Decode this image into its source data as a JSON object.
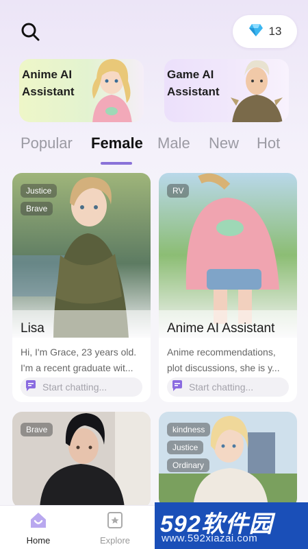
{
  "header": {
    "search_icon": "search-icon",
    "gem_icon": "diamond-icon",
    "gem_count": "13"
  },
  "assistants": [
    {
      "label": "Anime AI Assistant"
    },
    {
      "label": "Game AI Assistant"
    }
  ],
  "tabs": [
    {
      "label": "Popular",
      "active": false
    },
    {
      "label": "Female",
      "active": true
    },
    {
      "label": "Male",
      "active": false
    },
    {
      "label": "New",
      "active": false
    },
    {
      "label": "Hot",
      "active": false
    }
  ],
  "cards": [
    {
      "tags": [
        "Justice",
        "Brave"
      ],
      "name": "Lisa",
      "desc_line1": "Hi, I'm Grace, 23 years old.",
      "desc_line2": "I'm a recent graduate wit...",
      "chat_label": "Start chatting..."
    },
    {
      "tags": [
        "RV"
      ],
      "name": "Anime AI Assistant",
      "desc_line1": "Anime recommendations,",
      "desc_line2": "plot discussions, she is y...",
      "chat_label": "Start chatting..."
    },
    {
      "tags": [
        "Brave"
      ]
    },
    {
      "tags": [
        "kindness",
        "Justice",
        "Ordinary"
      ]
    }
  ],
  "nav": {
    "home_label": "Home",
    "explore_label": "Explore"
  },
  "watermark": {
    "top": "592软件园",
    "bottom": "www.592xiazai.com"
  },
  "colors": {
    "accent": "#8a72d8",
    "chat_icon": "#8a6be0",
    "gem": "#3ab6f0"
  }
}
